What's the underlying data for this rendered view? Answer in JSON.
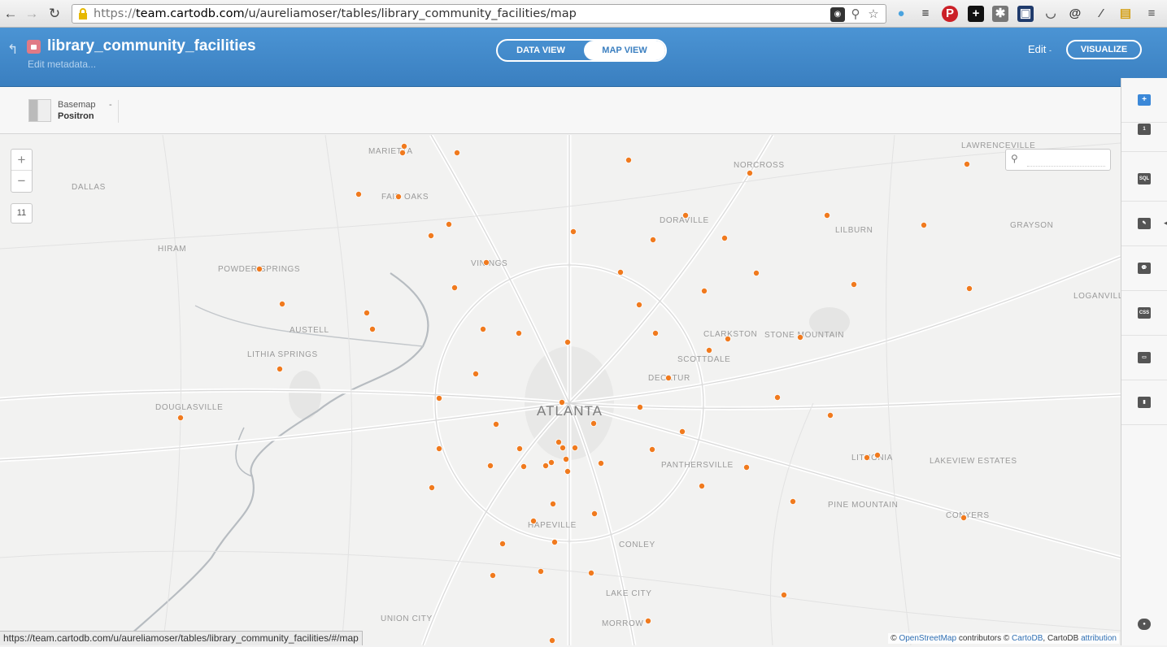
{
  "browser": {
    "url_scheme": "https://",
    "url_host": "team.cartodb.com",
    "url_path": "/u/aureliamoser/tables/library_community_facilities/map",
    "status_url": "https://team.cartodb.com/u/aureliamoser/tables/library_community_facilities/#/map"
  },
  "header": {
    "title": "library_community_facilities",
    "subtitle": "Edit metadata...",
    "tabs": {
      "data_view": "DATA VIEW",
      "map_view": "MAP VIEW"
    },
    "edit_label": "Edit",
    "visualize_label": "VISUALIZE",
    "accent": "#3f86c8"
  },
  "subbar": {
    "basemap_label": "Basemap",
    "basemap_value": "Positron"
  },
  "map": {
    "zoom_level": "11",
    "search_placeholder": "",
    "point_color": "#f07a1e",
    "places": [
      "MARIETTA",
      "DALLAS",
      "FAIR OAKS",
      "HIRAM",
      "POWDER SPRINGS",
      "VININGS",
      "AUSTELL",
      "LITHIA SPRINGS",
      "DOUGLASVILLE",
      "ATLANTA",
      "NORCROSS",
      "DORAVILLE",
      "LAWRENCEVILLE",
      "LILBURN",
      "GRAYSON",
      "LOGANVILLE",
      "CLARKSTON",
      "STONE MOUNTAIN",
      "SCOTTDALE",
      "DECATUR",
      "PANTHERSVILLE",
      "LITHONIA",
      "LAKEVIEW ESTATES",
      "PINE MOUNTAIN",
      "CONYERS",
      "HAPEVILLE",
      "CONLEY",
      "LAKE CITY",
      "UNION CITY",
      "MORROW"
    ],
    "attribution": {
      "prefix": "©",
      "osm": "OpenStreetMap",
      "mid": "contributors ©",
      "carto": "CartoDB",
      "suffix": ", CartoDB",
      "attr": "attribution"
    }
  },
  "right_panel": {
    "items": [
      {
        "name": "add-layer",
        "icon": "+"
      },
      {
        "name": "layer-number",
        "icon": "1"
      },
      {
        "name": "sql",
        "icon": "SQL"
      },
      {
        "name": "wizards",
        "icon": "✎"
      },
      {
        "name": "infowindow",
        "icon": "💬"
      },
      {
        "name": "css",
        "icon": "CSS"
      },
      {
        "name": "legends",
        "icon": "▭"
      },
      {
        "name": "filters",
        "icon": "▮"
      },
      {
        "name": "lightbulb",
        "icon": "●"
      }
    ]
  }
}
